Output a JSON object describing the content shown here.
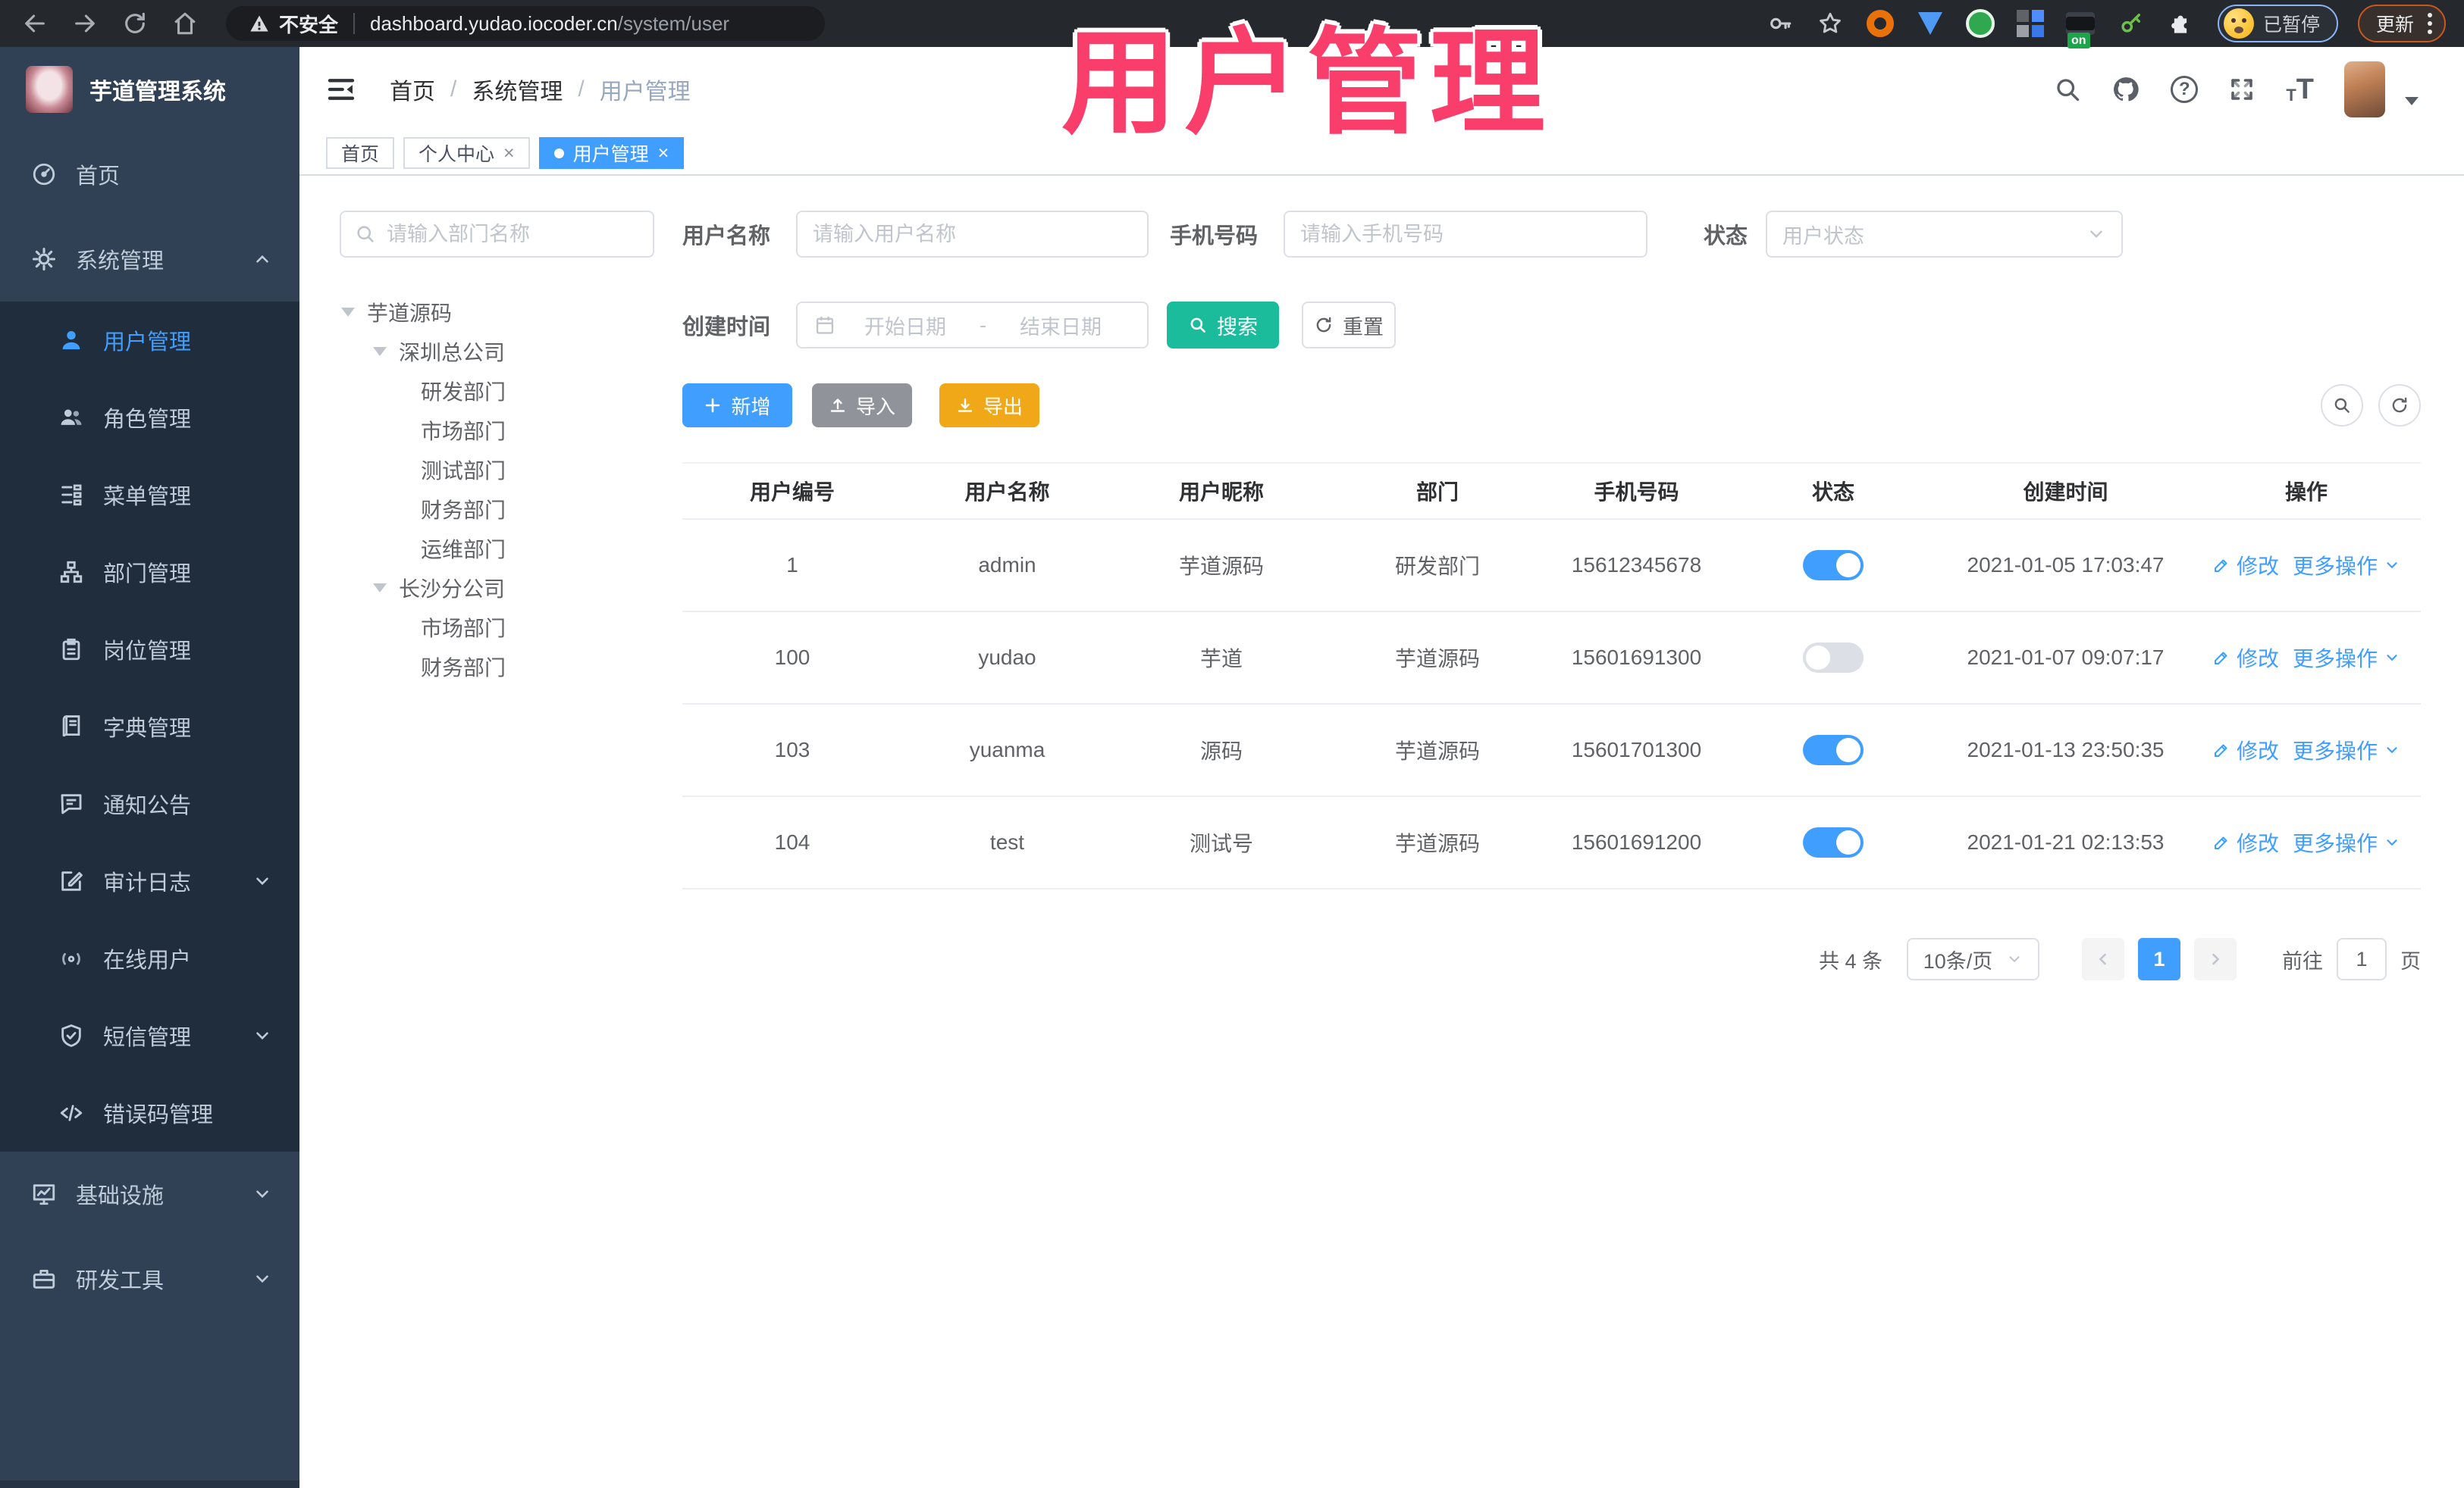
{
  "browser": {
    "security_label": "不安全",
    "url_host": "dashboard.yudao.iocoder.cn",
    "url_path": "/system/user",
    "extension_badge": "on",
    "profile_status": "已暂停",
    "update_label": "更新"
  },
  "header": {
    "logo_title": "芋道管理系统",
    "breadcrumb": {
      "home": "首页",
      "section": "系统管理",
      "current": "用户管理"
    }
  },
  "overlay_title": "用户管理",
  "ui": {
    "breadcrumb_separator": "/",
    "close_glyph": "×"
  },
  "tabs": [
    {
      "label": "首页"
    },
    {
      "label": "个人中心"
    },
    {
      "label": "用户管理"
    }
  ],
  "sidebar": {
    "items": [
      {
        "label": "首页"
      },
      {
        "label": "系统管理"
      },
      {
        "label": "用户管理"
      },
      {
        "label": "角色管理"
      },
      {
        "label": "菜单管理"
      },
      {
        "label": "部门管理"
      },
      {
        "label": "岗位管理"
      },
      {
        "label": "字典管理"
      },
      {
        "label": "通知公告"
      },
      {
        "label": "审计日志"
      },
      {
        "label": "在线用户"
      },
      {
        "label": "短信管理"
      },
      {
        "label": "错误码管理"
      },
      {
        "label": "基础设施"
      },
      {
        "label": "研发工具"
      }
    ]
  },
  "dept": {
    "search_placeholder": "请输入部门名称",
    "nodes": [
      {
        "label": "芋道源码"
      },
      {
        "label": "深圳总公司"
      },
      {
        "label": "研发部门"
      },
      {
        "label": "市场部门"
      },
      {
        "label": "测试部门"
      },
      {
        "label": "财务部门"
      },
      {
        "label": "运维部门"
      },
      {
        "label": "长沙分公司"
      },
      {
        "label": "市场部门"
      },
      {
        "label": "财务部门"
      }
    ]
  },
  "filter": {
    "username_label": "用户名称",
    "username_placeholder": "请输入用户名称",
    "mobile_label": "手机号码",
    "mobile_placeholder": "请输入手机号码",
    "status_label": "状态",
    "status_placeholder": "用户状态",
    "date_label": "创建时间",
    "date_start_placeholder": "开始日期",
    "date_separator": "-",
    "date_end_placeholder": "结束日期",
    "search_button": "搜索",
    "reset_button": "重置"
  },
  "toolbar": {
    "add": "新增",
    "import": "导入",
    "export": "导出"
  },
  "table": {
    "headers": [
      "用户编号",
      "用户名称",
      "用户昵称",
      "部门",
      "手机号码",
      "状态",
      "创建时间",
      "操作"
    ],
    "actions": {
      "edit": "修改",
      "more": "更多操作"
    },
    "rows": [
      {
        "id": "1",
        "username": "admin",
        "nickname": "芋道源码",
        "dept": "研发部门",
        "mobile": "15612345678",
        "status": true,
        "created": "2021-01-05 17:03:47"
      },
      {
        "id": "100",
        "username": "yudao",
        "nickname": "芋道",
        "dept": "芋道源码",
        "mobile": "15601691300",
        "status": false,
        "created": "2021-01-07 09:07:17"
      },
      {
        "id": "103",
        "username": "yuanma",
        "nickname": "源码",
        "dept": "芋道源码",
        "mobile": "15601701300",
        "status": true,
        "created": "2021-01-13 23:50:35"
      },
      {
        "id": "104",
        "username": "test",
        "nickname": "测试号",
        "dept": "芋道源码",
        "mobile": "15601691200",
        "status": true,
        "created": "2021-01-21 02:13:53"
      }
    ]
  },
  "pagination": {
    "total": "共 4 条",
    "page_size": "10条/页",
    "page": "1",
    "goto_label": "前往",
    "goto_value": "1",
    "unit_label": "页"
  },
  "colors": {
    "primary": "#409EFF",
    "search_teal": "#1ABC9C",
    "export_yellow": "#F0A818",
    "import_gray": "#909399",
    "annotation_pink": "#FA3E6C",
    "sidebar_bg": "#304156",
    "submenu_bg": "#1F2D3D"
  }
}
